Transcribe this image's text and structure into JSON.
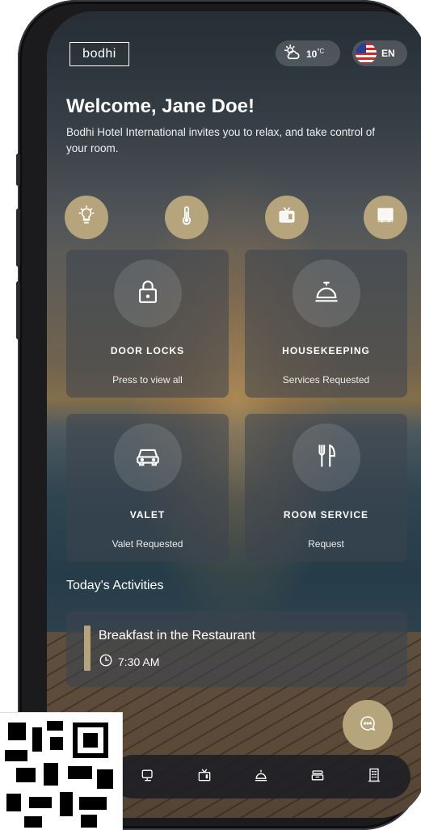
{
  "app": {
    "logo_text": "bodhi",
    "accent_color": "#b5a47c"
  },
  "status": {
    "weather_icon": "partly-cloudy-icon",
    "temperature": "10",
    "temperature_unit": "°C",
    "language": "EN",
    "language_flag": "us-flag-icon"
  },
  "welcome": {
    "title": "Welcome, Jane Doe!",
    "subtitle": "Bodhi Hotel International invites you to relax, and take control of your room."
  },
  "quick_controls": [
    {
      "icon": "lightbulb-icon"
    },
    {
      "icon": "thermometer-icon"
    },
    {
      "icon": "tv-icon"
    },
    {
      "icon": "window-blinds-icon"
    }
  ],
  "cards": [
    {
      "icon": "lock-icon",
      "title": "DOOR LOCKS",
      "subtitle": "Press to view all"
    },
    {
      "icon": "service-bell-icon",
      "title": "HOUSEKEEPING",
      "subtitle": "Services Requested"
    },
    {
      "icon": "car-icon",
      "title": "VALET",
      "subtitle": "Valet Requested"
    },
    {
      "icon": "cutlery-icon",
      "title": "ROOM SERVICE",
      "subtitle": "Request"
    }
  ],
  "activities": {
    "section_title": "Today's Activities",
    "items": [
      {
        "title": "Breakfast in the Restaurant",
        "time": "7:30 AM"
      }
    ]
  },
  "nav": [
    {
      "icon": "chat-devices-icon"
    },
    {
      "icon": "tv-icon"
    },
    {
      "icon": "service-bell-icon"
    },
    {
      "icon": "tray-icon"
    },
    {
      "icon": "building-icon"
    }
  ],
  "fab": {
    "icon": "chat-bubble-icon"
  }
}
